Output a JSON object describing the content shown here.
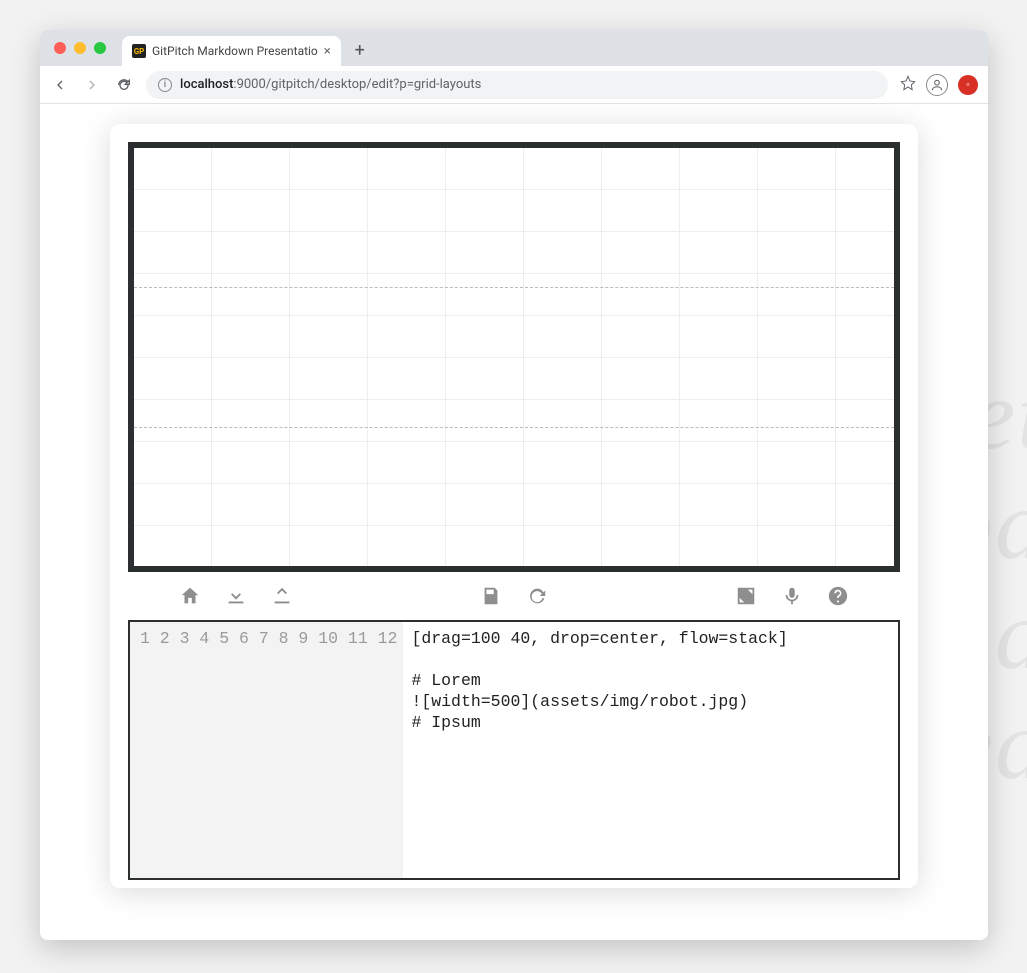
{
  "browser": {
    "tab_title": "GitPitch Markdown Presentatio",
    "tab_favicon_text": "GP",
    "url_host": "localhost",
    "url_path": ":9000/gitpitch/desktop/edit?p=grid-layouts"
  },
  "toolbar": {
    "home": "home",
    "download": "download",
    "upload": "upload",
    "save": "save",
    "refresh": "refresh",
    "expand": "expand",
    "mic": "mic",
    "help": "help"
  },
  "editor": {
    "line_count": 12,
    "lines": [
      "[drag=100 40, drop=center, flow=stack]",
      "",
      "# Lorem",
      "![width=500](assets/img/robot.jpg)",
      "# Ipsum",
      "",
      "",
      "",
      "",
      "",
      "",
      ""
    ]
  },
  "ghost": {
    "l1": "et",
    "l2": "pa",
    "l3": "na",
    "l4": "ed"
  }
}
